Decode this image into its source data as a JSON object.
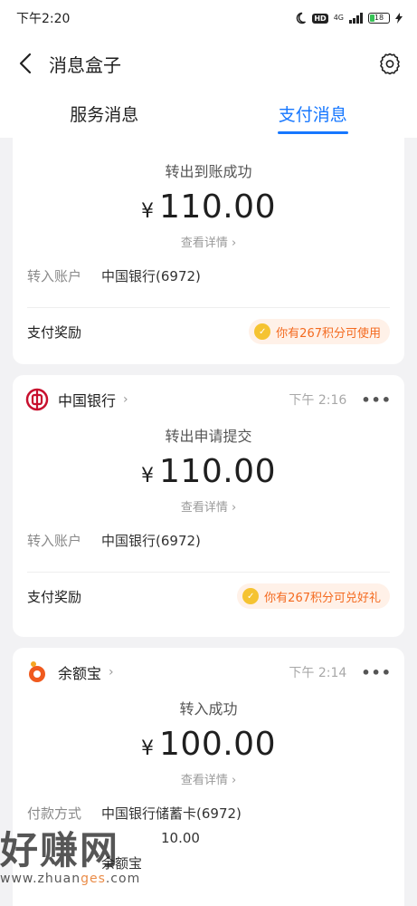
{
  "status_bar": {
    "time": "下午2:20",
    "network": "4G",
    "battery": "18"
  },
  "header": {
    "title": "消息盒子"
  },
  "tabs": [
    {
      "label": "服务消息",
      "active": false
    },
    {
      "label": "支付消息",
      "active": true
    }
  ],
  "cards": [
    {
      "status": "转出到账成功",
      "currency": "¥",
      "amount": "110.00",
      "detail_link": "查看详情",
      "rows": [
        {
          "label": "转入账户",
          "value": "中国银行(6972)"
        }
      ],
      "reward_label": "支付奖励",
      "reward_text": "你有267积分可使用"
    },
    {
      "source": "中国银行",
      "time": "下午 2:16",
      "status": "转出申请提交",
      "currency": "¥",
      "amount": "110.00",
      "detail_link": "查看详情",
      "rows": [
        {
          "label": "转入账户",
          "value": "中国银行(6972)"
        }
      ],
      "reward_label": "支付奖励",
      "reward_text": "你有267积分可兑好礼"
    },
    {
      "source": "余额宝",
      "time": "下午 2:14",
      "status": "转入成功",
      "currency": "¥",
      "amount": "100.00",
      "detail_link": "查看详情",
      "rows": [
        {
          "label": "付款方式",
          "value": "中国银行储蓄卡(6972)"
        },
        {
          "label": "",
          "value": "10.00"
        },
        {
          "label": "",
          "value": "余额宝"
        }
      ]
    }
  ],
  "watermark": {
    "main": "好赚网",
    "url_prefix": "www.zhuan",
    "url_mid": "ges",
    "url_suffix": ".com"
  },
  "colors": {
    "accent": "#1677ff",
    "reward": "#f46a1f",
    "boc_red": "#c8102e",
    "yuebao_orange": "#f05a1e"
  },
  "icons": [
    "back-arrow-icon",
    "gear-icon",
    "moon-icon",
    "hd-icon",
    "signal-icon",
    "battery-icon",
    "charging-icon",
    "boc-logo-icon",
    "yuebao-logo-icon",
    "chevron-right-icon",
    "more-icon",
    "coin-icon"
  ]
}
